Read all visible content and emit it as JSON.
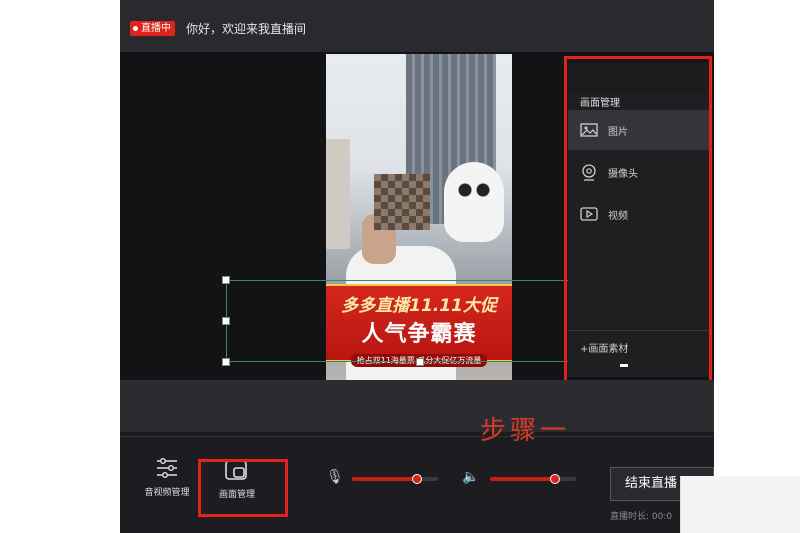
{
  "topbar": {
    "live_badge": "直播中",
    "welcome": "你好，欢迎来我直播间"
  },
  "banner": {
    "line1": "多多直播11.11大促",
    "line2": "人气争霸赛",
    "line3": "抢占双11海量票 瓜分大促亿万流量"
  },
  "panel": {
    "title": "画面管理",
    "items": [
      {
        "label": "图片",
        "icon": "image-icon",
        "active": true
      },
      {
        "label": "摄像头",
        "icon": "camera-icon",
        "active": false
      },
      {
        "label": "视频",
        "icon": "video-icon",
        "active": false
      }
    ],
    "add_label": "+画面素材"
  },
  "step_label": "步骤一",
  "bottom": {
    "tools": [
      {
        "label": "音视频管理",
        "icon": "sliders-icon"
      },
      {
        "label": "画面管理",
        "icon": "screen-manage-icon"
      }
    ],
    "mic_level": 0.74,
    "speaker_level": 0.74,
    "end_button": "结束直播",
    "duration": "直播时长: 00:0"
  },
  "colors": {
    "accent_red": "#e0241b",
    "slider_red": "#c22018",
    "background": "#1c1c20"
  }
}
